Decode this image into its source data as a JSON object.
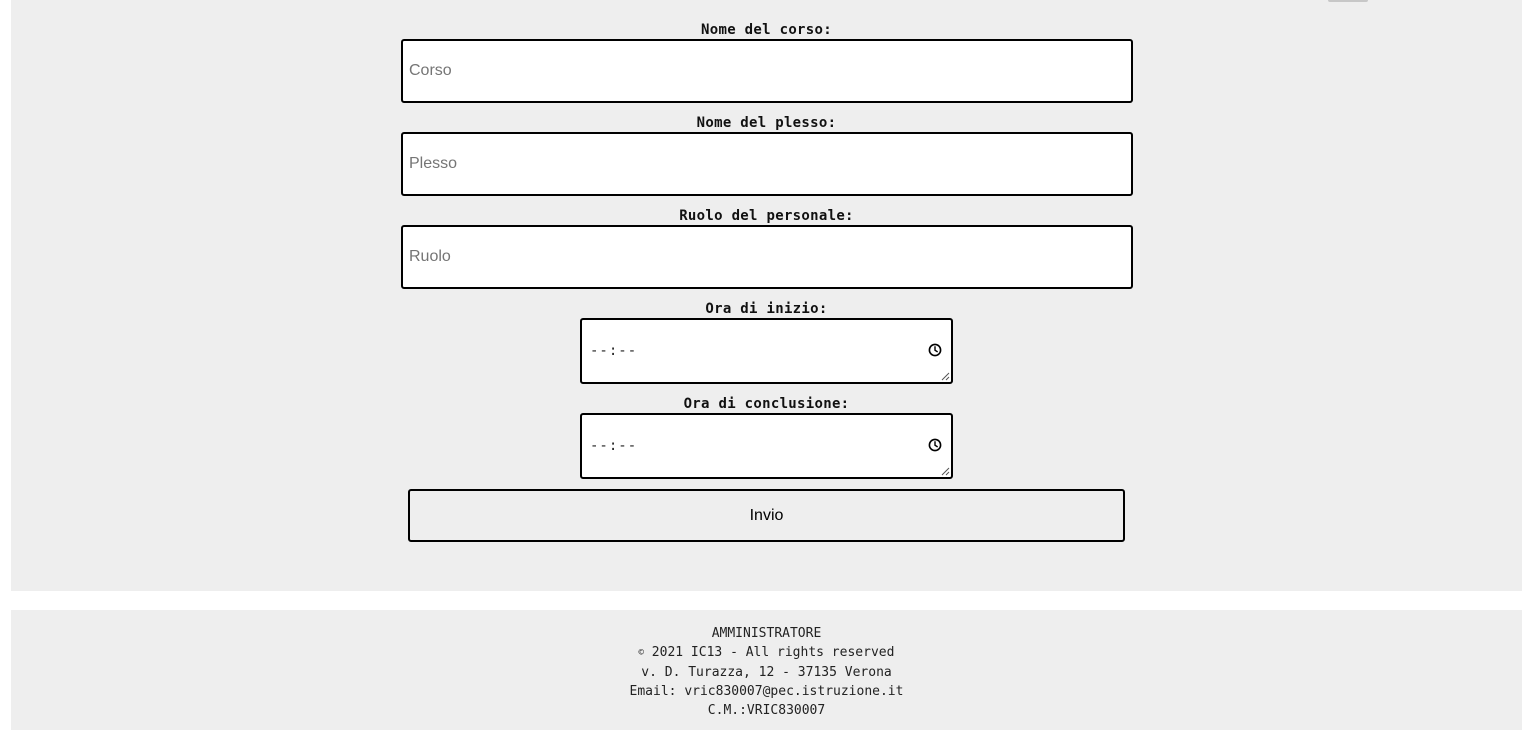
{
  "form": {
    "course": {
      "label": "Nome del corso:",
      "placeholder": "Corso",
      "value": ""
    },
    "site": {
      "label": "Nome del plesso:",
      "placeholder": "Plesso",
      "value": ""
    },
    "role": {
      "label": "Ruolo del personale:",
      "placeholder": "Ruolo",
      "value": ""
    },
    "start_time": {
      "label": "Ora di inizio:",
      "value": "--:--"
    },
    "end_time": {
      "label": "Ora di conclusione:",
      "value": "--:--"
    },
    "submit_label": "Invio"
  },
  "footer": {
    "role": "AMMINISTRATORE",
    "copyright_symbol": "©",
    "copyright": "2021 IC13 - All rights reserved",
    "address": "v. D. Turazza, 12 - 37135 Verona",
    "email": "Email: vric830007@pec.istruzione.it",
    "code": "C.M.:VRIC830007"
  },
  "icons": {
    "time_picker": "clock-icon",
    "resize": "resize-grip-icon"
  },
  "colors": {
    "panel_background": "#eeeeee",
    "border": "#000000",
    "placeholder": "#757575"
  }
}
